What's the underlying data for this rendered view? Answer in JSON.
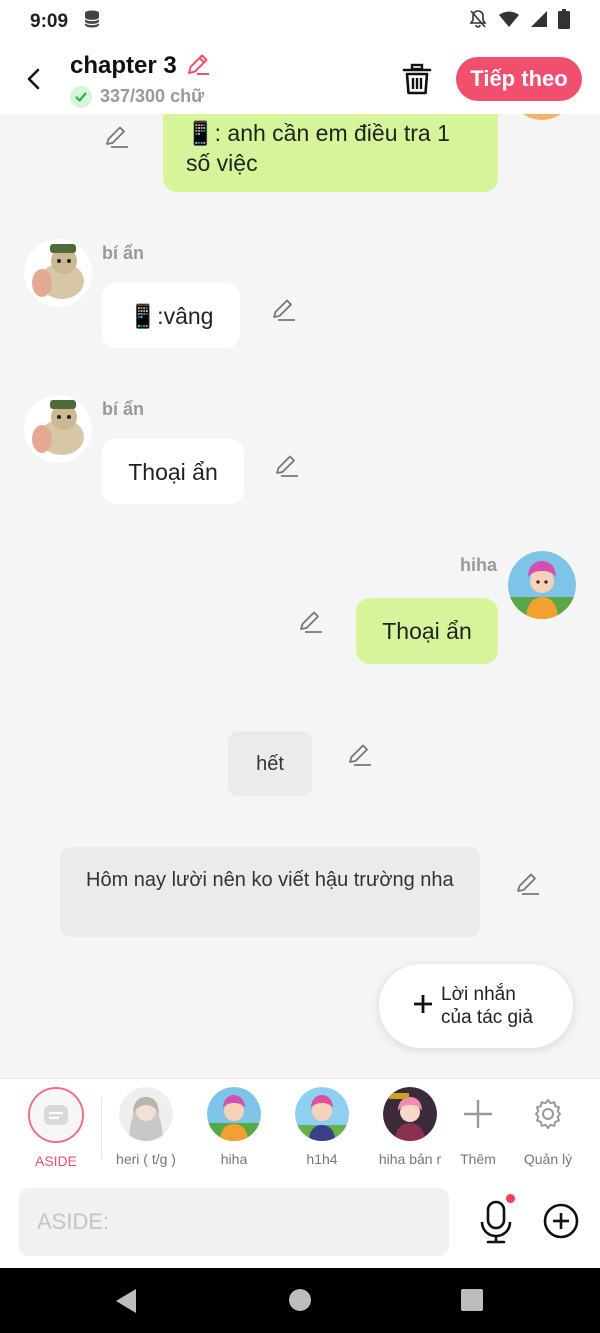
{
  "status": {
    "time": "9:09"
  },
  "header": {
    "title": "chapter 3",
    "word_count": "337/300 chữ",
    "next_label": "Tiếp theo"
  },
  "messages": {
    "m1_text": "📱: anh cần em điều tra 1 số việc",
    "m2_sender": "bí ẩn",
    "m2_text": "📱:vâng",
    "m3_sender": "bí ẩn",
    "m3_text": "Thoại ẩn",
    "m4_sender": "hiha",
    "m4_text": "Thoại ẩn",
    "m5_text": "hết",
    "m6_text": "Hôm nay lười nên ko viết hậu trường nha"
  },
  "author_note": {
    "label": "Lời nhắn của tác giả"
  },
  "characters": [
    {
      "name": "ASIDE"
    },
    {
      "name": "heri ( t/g )"
    },
    {
      "name": "hiha"
    },
    {
      "name": "h1h4"
    },
    {
      "name": "hiha bản r"
    },
    {
      "name": "Thêm"
    },
    {
      "name": "Quản lý"
    }
  ],
  "input": {
    "placeholder": "ASIDE:"
  },
  "colors": {
    "accent": "#f0506e",
    "bubble_green": "#d6f59a",
    "bubble_white": "#ffffff"
  }
}
